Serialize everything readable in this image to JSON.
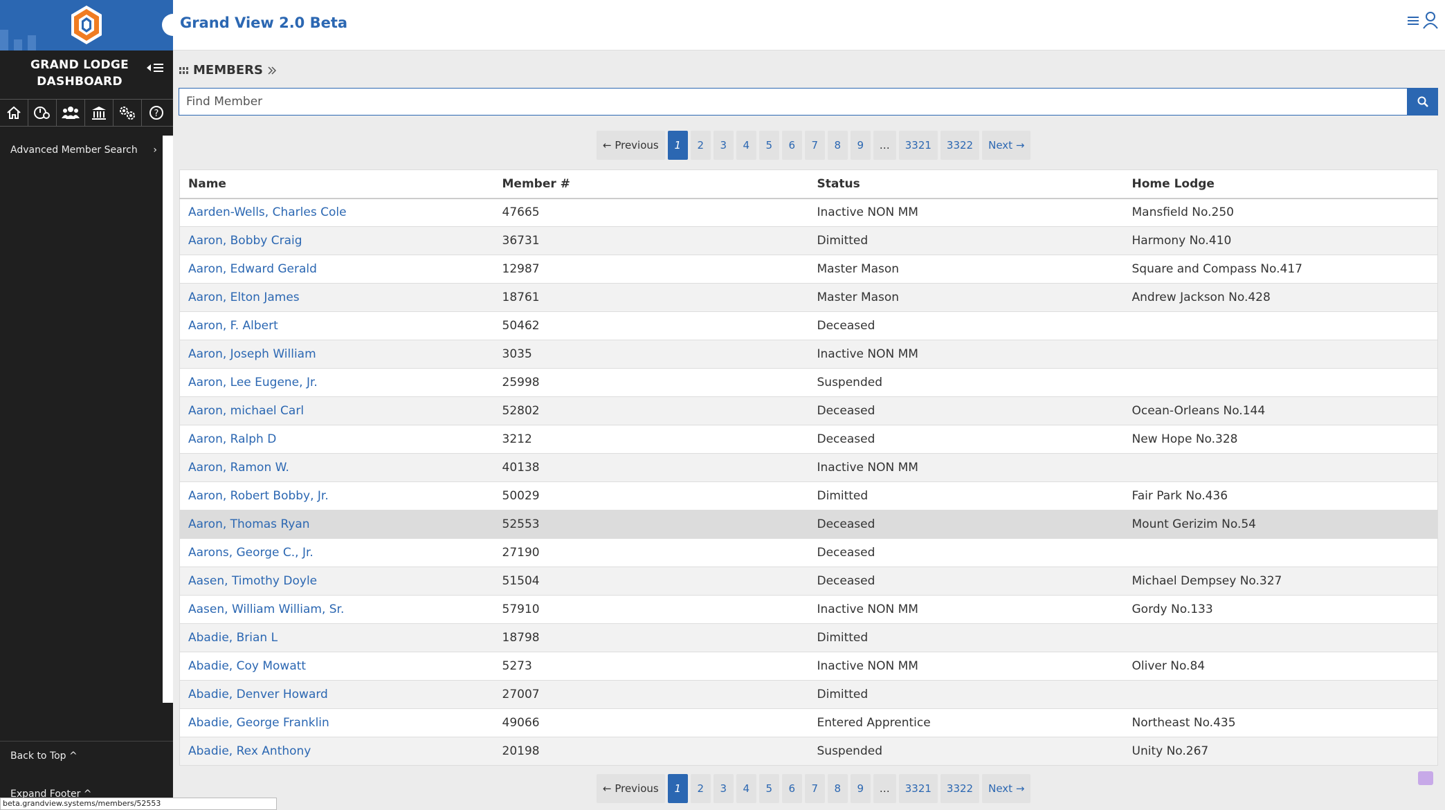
{
  "app": {
    "title": "Grand View 2.0 Beta",
    "brand_title_line1": "GRAND LODGE",
    "brand_title_line2": "DASHBOARD",
    "accent_color": "#2b67b2",
    "logo_colors": [
      "#f07c22",
      "#2b67b2",
      "#ffffff"
    ]
  },
  "sidebar": {
    "nav_icons": [
      "home-icon",
      "dashboard-settings-icon",
      "members-icon",
      "lodge-building-icon",
      "settings-gears-icon",
      "help-icon"
    ],
    "advanced_search_label": "Advanced Member Search",
    "back_to_top": "Back to Top ^",
    "expand_footer": "Expand Footer ^"
  },
  "status_url": "beta.grandview.systems/members/52553",
  "breadcrumb": {
    "label": "MEMBERS",
    "icon": "grid-icon",
    "separator_icon": "double-chevron-right-icon"
  },
  "search": {
    "placeholder": "Find Member",
    "value": ""
  },
  "pagination": {
    "previous": "← Previous",
    "next": "Next →",
    "pages": [
      "1",
      "2",
      "3",
      "4",
      "5",
      "6",
      "7",
      "8",
      "9",
      "…",
      "3321",
      "3322"
    ],
    "current": "1"
  },
  "table": {
    "headers": [
      "Name",
      "Member #",
      "Status",
      "Home Lodge"
    ],
    "hover_row_index": 11,
    "rows": [
      [
        "Aarden-Wells, Charles Cole",
        "47665",
        "Inactive NON MM",
        "Mansfield No.250"
      ],
      [
        "Aaron, Bobby Craig",
        "36731",
        "Dimitted",
        "Harmony No.410"
      ],
      [
        "Aaron, Edward Gerald",
        "12987",
        "Master Mason",
        "Square and Compass No.417"
      ],
      [
        "Aaron, Elton James",
        "18761",
        "Master Mason",
        "Andrew Jackson No.428"
      ],
      [
        "Aaron, F. Albert",
        "50462",
        "Deceased",
        ""
      ],
      [
        "Aaron, Joseph William",
        "3035",
        "Inactive NON MM",
        ""
      ],
      [
        "Aaron, Lee Eugene, Jr.",
        "25998",
        "Suspended",
        ""
      ],
      [
        "Aaron, michael Carl",
        "52802",
        "Deceased",
        "Ocean-Orleans No.144"
      ],
      [
        "Aaron, Ralph D",
        "3212",
        "Deceased",
        "New Hope No.328"
      ],
      [
        "Aaron, Ramon W.",
        "40138",
        "Inactive NON MM",
        ""
      ],
      [
        "Aaron, Robert Bobby, Jr.",
        "50029",
        "Dimitted",
        "Fair Park No.436"
      ],
      [
        "Aaron, Thomas Ryan",
        "52553",
        "Deceased",
        "Mount Gerizim No.54"
      ],
      [
        "Aarons, George C., Jr.",
        "27190",
        "Deceased",
        ""
      ],
      [
        "Aasen, Timothy Doyle",
        "51504",
        "Deceased",
        "Michael Dempsey No.327"
      ],
      [
        "Aasen, William William, Sr.",
        "57910",
        "Inactive NON MM",
        "Gordy No.133"
      ],
      [
        "Abadie, Brian L",
        "18798",
        "Dimitted",
        ""
      ],
      [
        "Abadie, Coy Mowatt",
        "5273",
        "Inactive NON MM",
        "Oliver No.84"
      ],
      [
        "Abadie, Denver Howard",
        "27007",
        "Dimitted",
        ""
      ],
      [
        "Abadie, George Franklin",
        "49066",
        "Entered Apprentice",
        "Northeast No.435"
      ],
      [
        "Abadie, Rex Anthony",
        "20198",
        "Suspended",
        "Unity No.267"
      ]
    ]
  }
}
